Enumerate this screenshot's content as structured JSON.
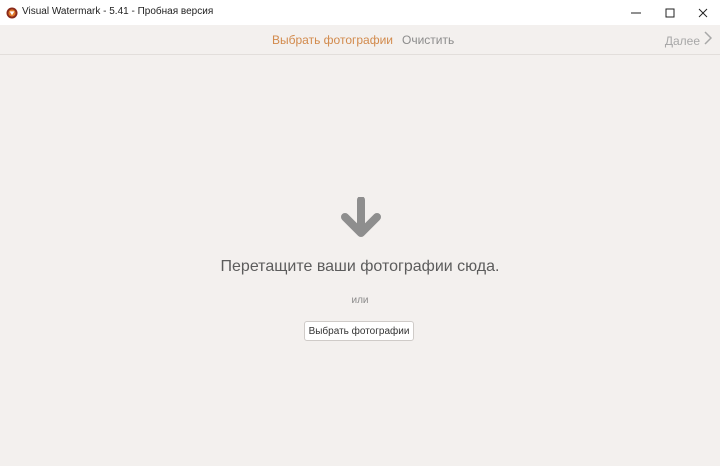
{
  "window": {
    "title": "Visual Watermark - 5.41 - Пробная версия",
    "icon": "app-logo-icon",
    "controls": [
      "minimize-icon",
      "maximize-icon",
      "close-icon"
    ]
  },
  "toolbar": {
    "select_photos_label": "Выбрать фотографии",
    "clear_label": "Очистить",
    "next_label": "Далее",
    "next_icon": "chevron-right-icon"
  },
  "dropzone": {
    "icon": "arrow-down-icon",
    "prompt": "Перетащите ваши фотографии сюда.",
    "or_label": "или",
    "button_label": "Выбрать фотографии"
  },
  "colors": {
    "accent": "#d28a4c",
    "background": "#f3f0ee",
    "arrow": "#8e8e8e"
  }
}
